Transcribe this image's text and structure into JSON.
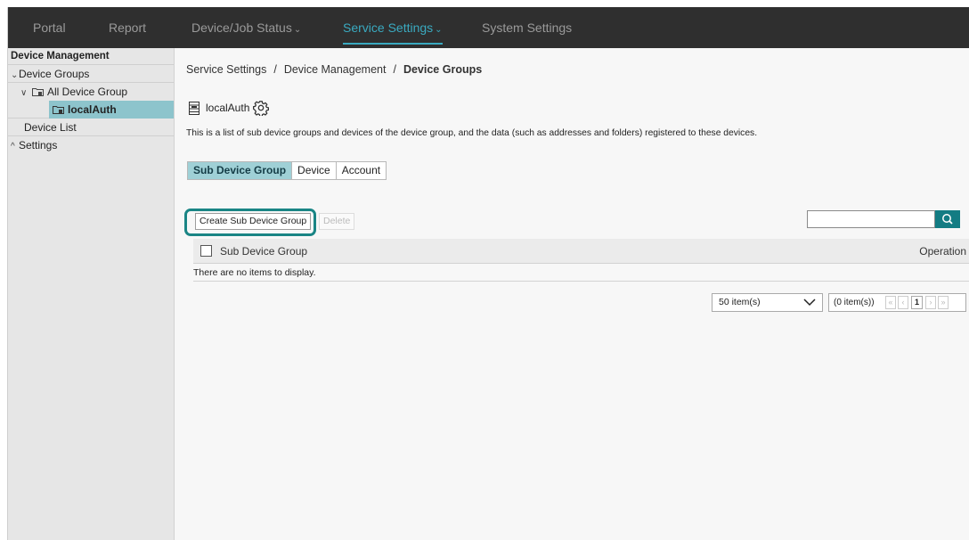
{
  "nav": {
    "items": [
      {
        "label": "Portal"
      },
      {
        "label": "Report"
      },
      {
        "label": "Device/Job Status",
        "chevron": "⌄"
      },
      {
        "label": "Service Settings",
        "chevron": "⌄"
      },
      {
        "label": "System Settings"
      }
    ],
    "active": "Service Settings"
  },
  "sidebar": {
    "heading": "Device Management",
    "device_groups": "Device Groups",
    "all_device_group": "All Device Group",
    "selected_group": "localAuth",
    "device_list": "Device List",
    "settings": "Settings",
    "caret_down": "⌄",
    "caret_up": "^",
    "tree_caret": "∨"
  },
  "breadcrumb": {
    "item1": "Service Settings",
    "item2": "Device Management",
    "current": "Device Groups",
    "separator": "/"
  },
  "group": {
    "name": "localAuth",
    "description": "This is a list of sub device groups and devices of the device group, and the data (such as addresses and folders) registered to these devices."
  },
  "tabs": {
    "sub_device_group": "Sub Device Group",
    "device": "Device",
    "account": "Account"
  },
  "toolbar": {
    "create_label": "Create Sub Device Group",
    "delete_label": "Delete",
    "search_value": ""
  },
  "table": {
    "col_name": "Sub Device Group",
    "col_operation": "Operation",
    "empty_message": "There are no items to display."
  },
  "pager": {
    "per_page": "50 item(s)",
    "count": "(0 item(s))",
    "page": "1",
    "first": "«",
    "prev": "‹",
    "next": "›",
    "last": "»"
  },
  "colors": {
    "accent": "#3aaac0",
    "selected_bg": "#8dc4cc",
    "highlight_border": "#1a8585",
    "search_button": "#137c83"
  }
}
